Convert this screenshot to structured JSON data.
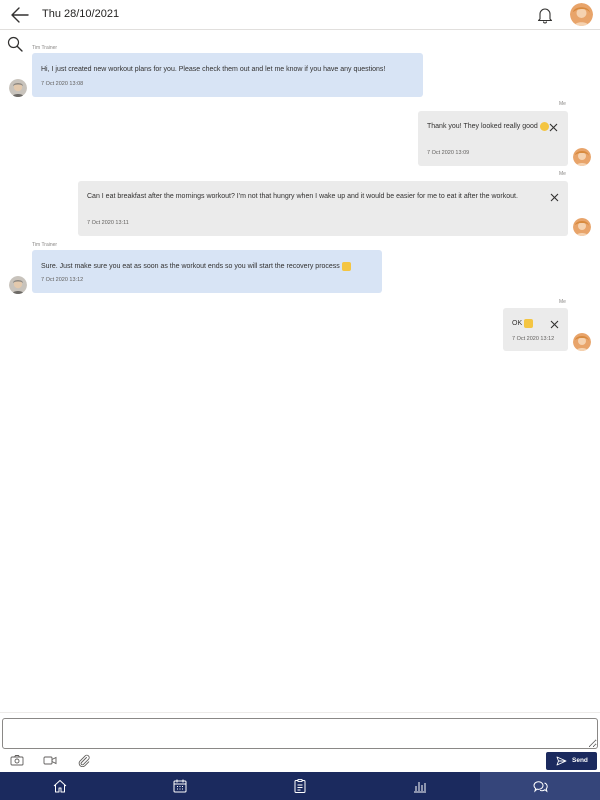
{
  "header": {
    "title": "Thu 28/10/2021",
    "back_icon": "arrow-left-icon",
    "notifications_icon": "bell-icon"
  },
  "search": {
    "icon": "search-icon"
  },
  "messages": [
    {
      "sender": "Tim Trainer",
      "text": "Hi, I just created new workout plans for you. Please check them out and let me know if you have any questions!",
      "timestamp": "7 Oct 2020 13:08",
      "from_me": false
    },
    {
      "sender": "Me",
      "text": "Thank you! They looked really good",
      "emoji": "smiling-face",
      "timestamp": "7 Oct 2020 13:09",
      "from_me": true
    },
    {
      "sender": "Me",
      "text": "Can I eat breakfast after the mornings workout? I'm not that hungry when I wake up and it would be easier for me to eat it after the workout.",
      "timestamp": "7 Oct 2020 13:11",
      "from_me": true
    },
    {
      "sender": "Tim Trainer",
      "text": "Sure. Just make sure you eat as soon as the workout ends so you will start the recovery process",
      "emoji": "flexed-biceps",
      "timestamp": "7 Oct 2020 13:12",
      "from_me": false
    },
    {
      "sender": "Me",
      "text": "OK",
      "emoji": "raised-hands",
      "timestamp": "7 Oct 2020 13:12",
      "from_me": true
    }
  ],
  "composer": {
    "placeholder": "",
    "send_label": "Send",
    "tools": [
      "camera-icon",
      "video-icon",
      "paperclip-icon"
    ]
  },
  "nav": {
    "items": [
      "home-icon",
      "calendar-icon",
      "clipboard-icon",
      "bar-chart-icon",
      "chat-icon"
    ],
    "active": "chat-icon"
  },
  "colors": {
    "navy": "#1b2a5e",
    "trainer_bubble": "#d8e4f5",
    "my_bubble": "#ebebeb"
  }
}
